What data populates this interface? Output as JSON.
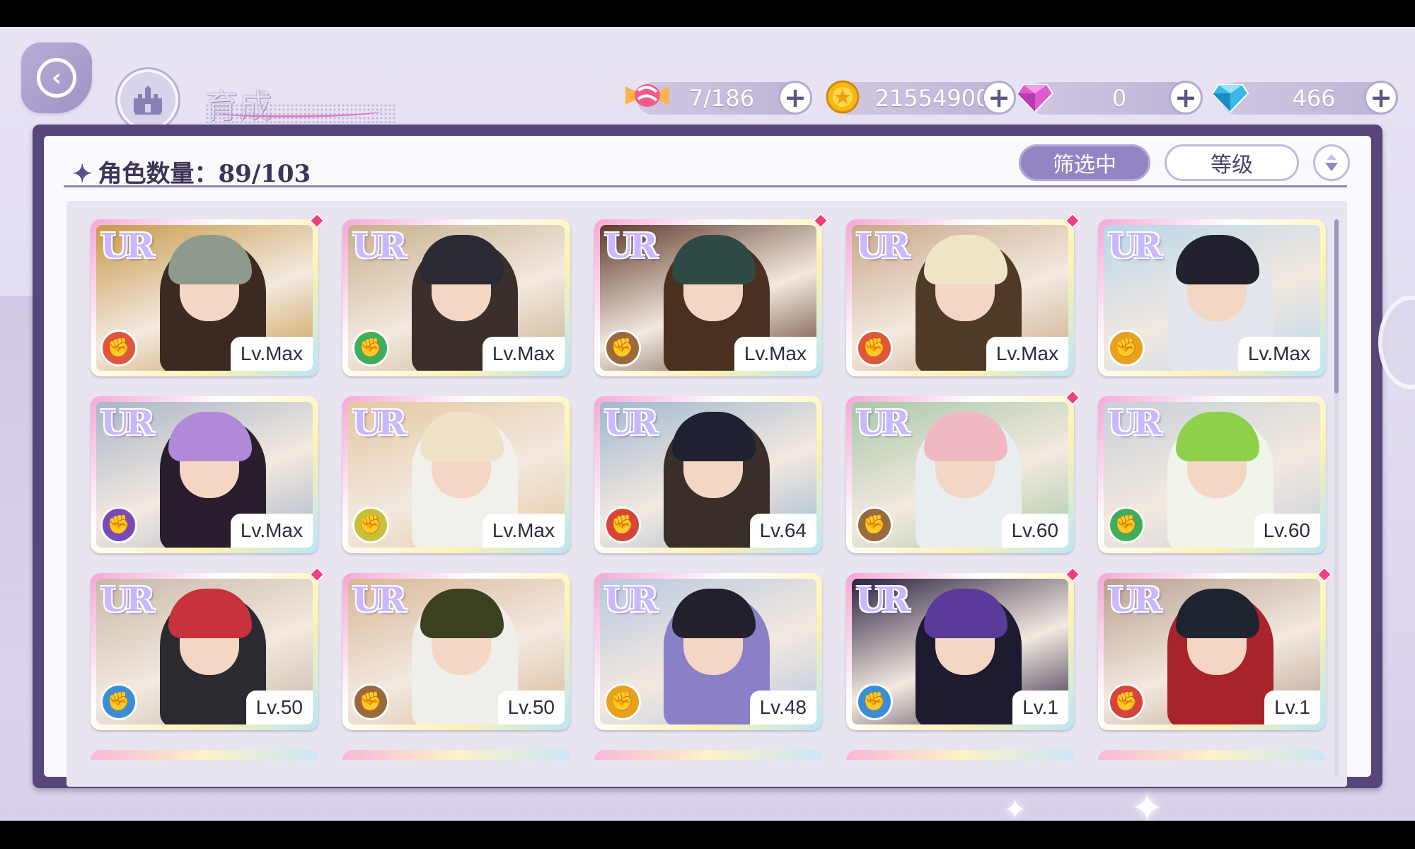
{
  "header": {
    "title": "育成",
    "back_icon": "back-icon",
    "home_icon": "castle-icon"
  },
  "currencies": [
    {
      "name": "candy",
      "icon": "candy-icon",
      "value": "7/186"
    },
    {
      "name": "coin",
      "icon": "coin-icon",
      "value": "21554900"
    },
    {
      "name": "pink-diamond",
      "icon": "pink-diamond-icon",
      "value": "0"
    },
    {
      "name": "blue-diamond",
      "icon": "blue-diamond-icon",
      "value": "466"
    }
  ],
  "panel": {
    "count_label": "角色数量：89/103",
    "filter_label": "筛选中",
    "sort_label": "等级",
    "order_icon": "sort-order-icon"
  },
  "colors": {
    "accent": "#9384c3",
    "panel_border": "#56467a",
    "new_dot": "#f0417f"
  },
  "cards": [
    {
      "rarity": "UR",
      "level": "Lv.Max",
      "attr_color": "#e0563a",
      "new": true,
      "hair": "#8e9a8c",
      "bg": "#c89a4a",
      "outfit": "#3b2a22"
    },
    {
      "rarity": "UR",
      "level": "Lv.Max",
      "attr_color": "#3fae5b",
      "new": false,
      "hair": "#2a2a35",
      "bg": "#c7b08c",
      "outfit": "#3a2f2a"
    },
    {
      "rarity": "UR",
      "level": "Lv.Max",
      "attr_color": "#9a6a3c",
      "new": true,
      "hair": "#2f4a45",
      "bg": "#5e3b2a",
      "outfit": "#4a3020"
    },
    {
      "rarity": "UR",
      "level": "Lv.Max",
      "attr_color": "#e0563a",
      "new": true,
      "hair": "#efe6c8",
      "bg": "#c9a888",
      "outfit": "#4e3a26"
    },
    {
      "rarity": "UR",
      "level": "Lv.Max",
      "attr_color": "#e6a21e",
      "new": false,
      "hair": "#22222e",
      "bg": "#b9d6ea",
      "outfit": "#e4e6ee"
    },
    {
      "rarity": "UR",
      "level": "Lv.Max",
      "attr_color": "#7a4ab8",
      "new": false,
      "hair": "#b08ad8",
      "bg": "#a8b6c8",
      "outfit": "#2a1e2e"
    },
    {
      "rarity": "UR",
      "level": "Lv.Max",
      "attr_color": "#c8c03a",
      "new": false,
      "hair": "#efe2c8",
      "bg": "#e4c8a0",
      "outfit": "#f2f0ea"
    },
    {
      "rarity": "UR",
      "level": "Lv.64",
      "attr_color": "#d9443a",
      "new": false,
      "hair": "#1e2230",
      "bg": "#9fb8d0",
      "outfit": "#3a2e28"
    },
    {
      "rarity": "UR",
      "level": "Lv.60",
      "attr_color": "#9a6a3c",
      "new": true,
      "hair": "#f0b8c0",
      "bg": "#a8c8a8",
      "outfit": "#e8eef0"
    },
    {
      "rarity": "UR",
      "level": "Lv.60",
      "attr_color": "#3fae5b",
      "new": false,
      "hair": "#8ed04a",
      "bg": "#c8d0d8",
      "outfit": "#f0f4ea"
    },
    {
      "rarity": "UR",
      "level": "Lv.50",
      "attr_color": "#3a8ed8",
      "new": true,
      "hair": "#c8323a",
      "bg": "#c8b8a8",
      "outfit": "#2a2a30"
    },
    {
      "rarity": "UR",
      "level": "Lv.50",
      "attr_color": "#9a6a3c",
      "new": false,
      "hair": "#3a4020",
      "bg": "#d8b898",
      "outfit": "#f0eee8"
    },
    {
      "rarity": "UR",
      "level": "Lv.48",
      "attr_color": "#e6a21e",
      "new": false,
      "hair": "#22202a",
      "bg": "#b8c8e0",
      "outfit": "#8a80c8"
    },
    {
      "rarity": "UR",
      "level": "Lv.1",
      "attr_color": "#3a8ed8",
      "new": true,
      "hair": "#5a3a9a",
      "bg": "#2a2240",
      "outfit": "#1e1a30"
    },
    {
      "rarity": "UR",
      "level": "Lv.1",
      "attr_color": "#d9443a",
      "new": true,
      "hair": "#1e2430",
      "bg": "#b8a090",
      "outfit": "#a8242a"
    }
  ]
}
